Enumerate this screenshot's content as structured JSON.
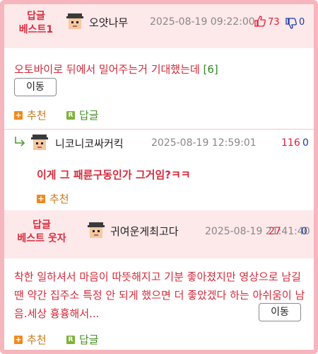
{
  "comments": [
    {
      "badge_line1": "답글",
      "badge_line2": "베스트1",
      "nickname": "오얏나무",
      "date": "2025-08-19 09:22:00",
      "upvotes": "73",
      "downvotes": "0",
      "body": "오토바이로 뒤에서 밀어주는거 기대했는데",
      "reply_count": "[6]",
      "move_label": "이동",
      "recommend_label": "추천",
      "reply_label": "답글"
    },
    {
      "nickname": "니코니코싸커킥",
      "date": "2025-08-19 12:59:01",
      "upvotes": "116",
      "downvotes": "0",
      "body": "이게 그 패륜구동인가 그거임?ㅋㅋ",
      "recommend_label": "추천"
    },
    {
      "badge_line1": "답글",
      "badge_line2": "베스트 웃자",
      "nickname": "귀여운게최고다",
      "date": "2025-08-19 21:41:40",
      "upvotes": "27",
      "downvotes": "0",
      "body": "착한 일하셔서 마음이 따뜻해지고 기분 좋아졌지만 영상으로 남길 땐 약간 집주소 특정 안 되게 했으면 더 좋았겠다 하는 아쉬움이 남음.세상 흉흉해서...",
      "move_label": "이동",
      "recommend_label": "추천",
      "reply_label": "답글"
    }
  ],
  "icons": {
    "thumbs_up": "thumbs-up-icon",
    "thumbs_down": "thumbs-down-icon",
    "reply_arrow": "reply-arrow-icon",
    "plus": "plus-icon",
    "reply_badge": "R"
  },
  "colors": {
    "accent_red": "#d63040",
    "header_bg": "#fde8ea",
    "border": "#f5b7bd",
    "upvote": "#e0203a",
    "downvote": "#1a3aa8"
  }
}
